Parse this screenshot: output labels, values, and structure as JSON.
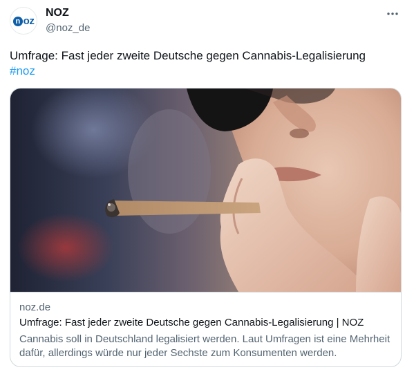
{
  "author": {
    "avatar_icon": "noz-logo-icon",
    "avatar_text_n": "n",
    "avatar_text_rest": "oz",
    "display_name": "NOZ",
    "handle": "@noz_de"
  },
  "menu": {
    "more_icon": "more-horizontal-icon"
  },
  "tweet": {
    "text": "Umfrage: Fast jeder zweite Deutsche gegen Cannabis-Legalisierung",
    "hashtag": "#noz"
  },
  "link_card": {
    "image_icon": "cannabis-joint-photo",
    "domain": "noz.de",
    "title": "Umfrage: Fast jeder zweite Deutsche gegen Cannabis-Legalisierung | NOZ",
    "description": "Cannabis soll in Deutschland legalisiert werden. Laut Umfragen ist eine Mehrheit dafür, allerdings würde nur jeder Sechste zum Konsumenten werden."
  },
  "colors": {
    "link": "#1d9bf0",
    "secondary_text": "#536471",
    "primary_text": "#0f1419",
    "border": "#cfd9de",
    "brand": "#0f5fa8"
  }
}
